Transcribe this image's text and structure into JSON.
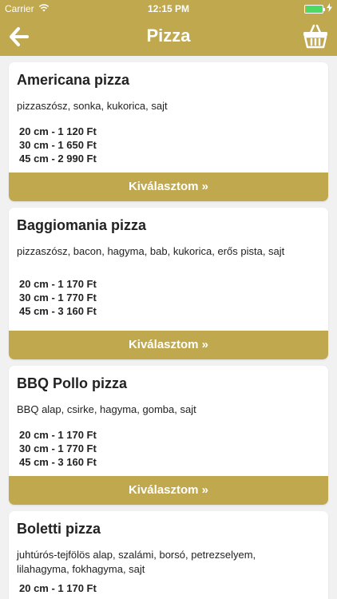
{
  "status_bar": {
    "carrier": "Carrier",
    "time": "12:15 PM",
    "battery_level": 1.0,
    "battery_color": "#4cd964"
  },
  "nav": {
    "title": "Pizza",
    "back_icon": "arrow-left-icon",
    "basket_icon": "basket-icon"
  },
  "theme": {
    "accent": "#c0a84e",
    "background": "#f1f1f1"
  },
  "pizzas": [
    {
      "name": "Americana pizza",
      "ingredients": "pizzaszósz, sonka, kukorica, sajt",
      "prices": [
        "20 cm - 1 120 Ft",
        "30 cm - 1 650 Ft",
        "45 cm - 2 990 Ft"
      ],
      "button_label": "Kiválasztom »"
    },
    {
      "name": "Baggiomania pizza",
      "ingredients": "pizzaszósz, bacon, hagyma, bab, kukorica, erős pista, sajt",
      "prices": [
        "20 cm - 1 170 Ft",
        "30 cm - 1 770 Ft",
        "45 cm - 3 160 Ft"
      ],
      "button_label": "Kiválasztom »"
    },
    {
      "name": "BBQ Pollo pizza",
      "ingredients": "BBQ alap, csirke, hagyma, gomba, sajt",
      "prices": [
        "20 cm - 1 170 Ft",
        "30 cm - 1 770 Ft",
        "45 cm - 3 160 Ft"
      ],
      "button_label": "Kiválasztom »"
    },
    {
      "name": "Boletti pizza",
      "ingredients": "juhtúrós-tejfölös alap, szalámi, borsó, petrezselyem, lilahagyma, fokhagyma, sajt",
      "prices": [
        "20 cm - 1 170 Ft"
      ],
      "button_label": ""
    }
  ]
}
